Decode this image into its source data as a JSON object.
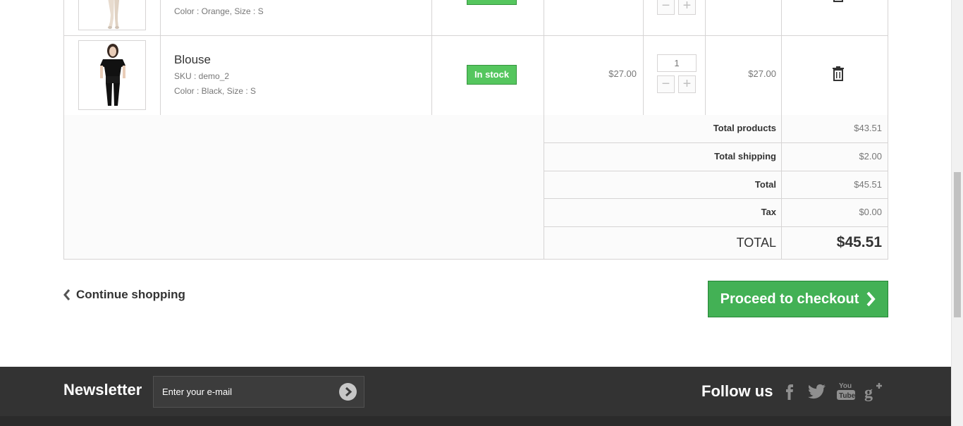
{
  "cart": {
    "row1": {
      "meta": "Color : Orange, Size : S"
    },
    "row2": {
      "name": "Blouse",
      "sku": "SKU : demo_2",
      "meta": "Color : Black, Size : S",
      "stock": "In stock",
      "unit_price": "$27.00",
      "qty": "1",
      "total": "$27.00"
    }
  },
  "summary": {
    "total_products_label": "Total products",
    "total_products_value": "$43.51",
    "total_shipping_label": "Total shipping",
    "total_shipping_value": "$2.00",
    "total_label": "Total",
    "total_value": "$45.51",
    "tax_label": "Tax",
    "tax_value": "$0.00",
    "grand_total_label": "TOTAL",
    "grand_total_value": "$45.51"
  },
  "actions": {
    "continue_label": "Continue shopping",
    "checkout_label": "Proceed to checkout"
  },
  "footer": {
    "newsletter_title": "Newsletter",
    "newsletter_placeholder": "Enter your e-mail",
    "follow_title": "Follow us",
    "social_icons": [
      "facebook-icon",
      "twitter-icon",
      "youtube-icon",
      "google-plus-icon"
    ]
  },
  "colors": {
    "accent_green": "#43b155",
    "stock_green": "#55c65e",
    "footer_bg": "#333333"
  }
}
